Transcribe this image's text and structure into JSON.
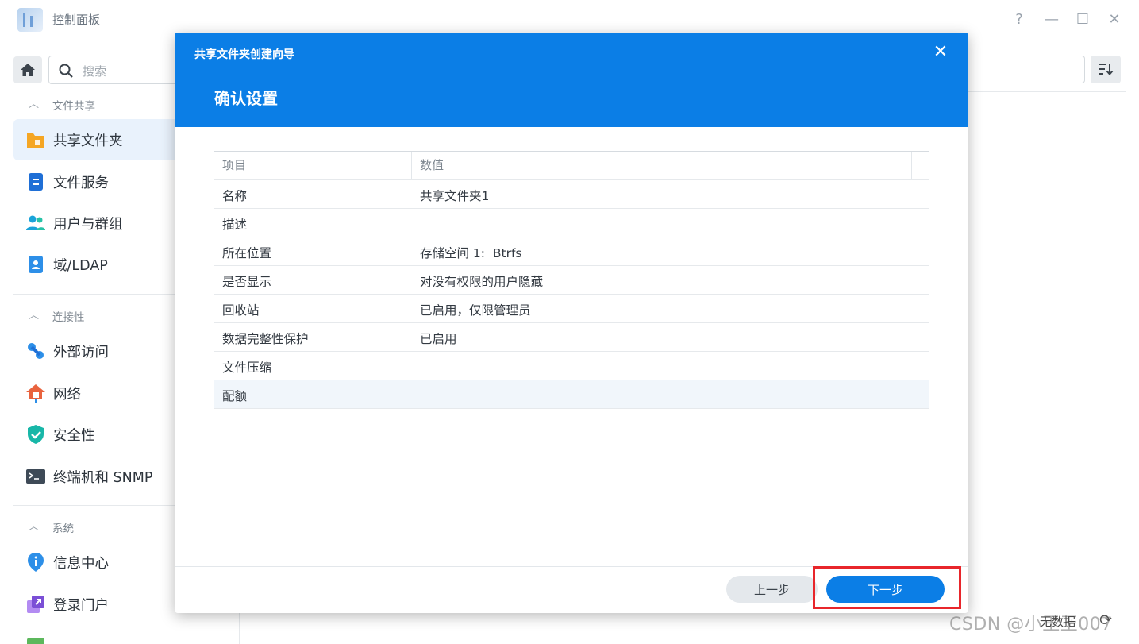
{
  "window": {
    "title": "控制面板",
    "help": "?",
    "minimize": "—",
    "maximize": "☐",
    "close": "✕"
  },
  "sidebar": {
    "search_placeholder": "搜索",
    "sections": [
      {
        "label": "文件共享",
        "chevron": "︿",
        "items": [
          {
            "label": "共享文件夹",
            "icon": "shared-folder-icon",
            "active": true
          },
          {
            "label": "文件服务",
            "icon": "file-services-icon"
          },
          {
            "label": "用户与群组",
            "icon": "users-groups-icon"
          },
          {
            "label": "域/LDAP",
            "icon": "domain-ldap-icon"
          }
        ]
      },
      {
        "label": "连接性",
        "chevron": "︿",
        "items": [
          {
            "label": "外部访问",
            "icon": "external-access-icon"
          },
          {
            "label": "网络",
            "icon": "network-icon"
          },
          {
            "label": "安全性",
            "icon": "security-shield-icon"
          },
          {
            "label": "终端机和 SNMP",
            "icon": "terminal-icon"
          }
        ]
      },
      {
        "label": "系统",
        "chevron": "︿",
        "items": [
          {
            "label": "信息中心",
            "icon": "info-center-icon"
          },
          {
            "label": "登录门户",
            "icon": "login-portal-icon"
          }
        ]
      }
    ]
  },
  "background": {
    "no_data": "无数据",
    "refresh": "⟳",
    "watermark": "CSDN @小王王007"
  },
  "dialog": {
    "title": "共享文件夹创建向导",
    "close": "✕",
    "step_title": "确认设置",
    "table": {
      "headers": [
        "项目",
        "数值"
      ],
      "rows": [
        {
          "key": "名称",
          "value": "共享文件夹1"
        },
        {
          "key": "描述",
          "value": ""
        },
        {
          "key": "所在位置",
          "value": "存储空间 1:  Btrfs"
        },
        {
          "key": "是否显示",
          "value": "对没有权限的用户隐藏"
        },
        {
          "key": "回收站",
          "value": "已启用，仅限管理员"
        },
        {
          "key": "数据完整性保护",
          "value": "已启用"
        },
        {
          "key": "文件压缩",
          "value": ""
        },
        {
          "key": "配额",
          "value": ""
        }
      ]
    },
    "buttons": {
      "prev": "上一步",
      "next": "下一步"
    }
  },
  "colors": {
    "accent": "#0b7ee6",
    "annotation": "#e8262b"
  }
}
